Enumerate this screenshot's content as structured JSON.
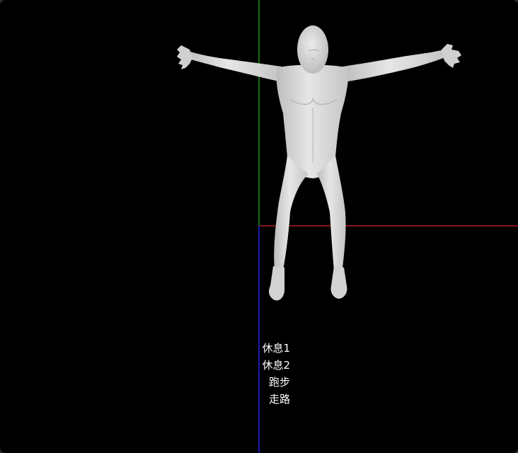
{
  "scene": {
    "background_color": "#000000",
    "axes": {
      "x_axis_color": "#d02020",
      "y_axis_color": "#20b020",
      "z_axis_color": "#2020d0"
    },
    "model": {
      "name": "human-t-pose",
      "color": "#d8d8d8"
    }
  },
  "animation_menu": {
    "items": [
      {
        "label": "休息1"
      },
      {
        "label": "休息2"
      },
      {
        "label": "跑步"
      },
      {
        "label": "走路"
      }
    ],
    "text_color": "#ffffff"
  }
}
